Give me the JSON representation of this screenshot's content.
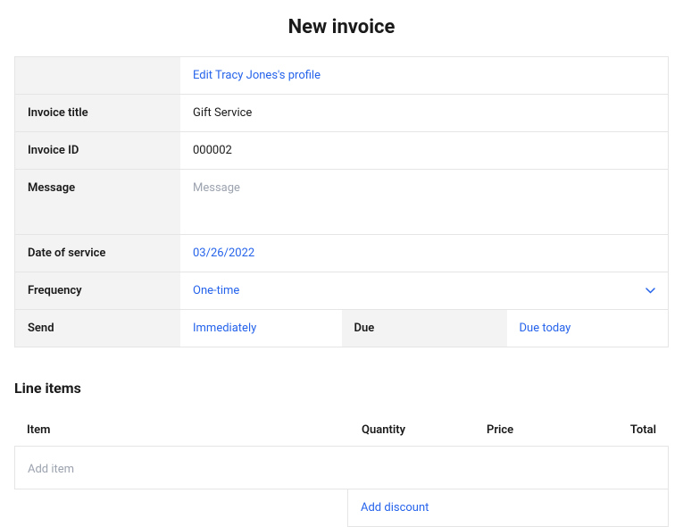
{
  "pageTitle": "New invoice",
  "form": {
    "editProfileLink": "Edit Tracy Jones's profile",
    "invoiceTitle": {
      "label": "Invoice title",
      "value": "Gift Service"
    },
    "invoiceId": {
      "label": "Invoice ID",
      "value": "000002"
    },
    "message": {
      "label": "Message",
      "placeholder": "Message"
    },
    "dateOfService": {
      "label": "Date of service",
      "value": "03/26/2022"
    },
    "frequency": {
      "label": "Frequency",
      "value": "One-time"
    },
    "send": {
      "label": "Send",
      "value": "Immediately"
    },
    "due": {
      "label": "Due",
      "value": "Due today"
    }
  },
  "lineItems": {
    "title": "Line items",
    "headers": {
      "item": "Item",
      "quantity": "Quantity",
      "price": "Price",
      "total": "Total"
    },
    "addItemPlaceholder": "Add item",
    "addDiscount": "Add discount"
  }
}
